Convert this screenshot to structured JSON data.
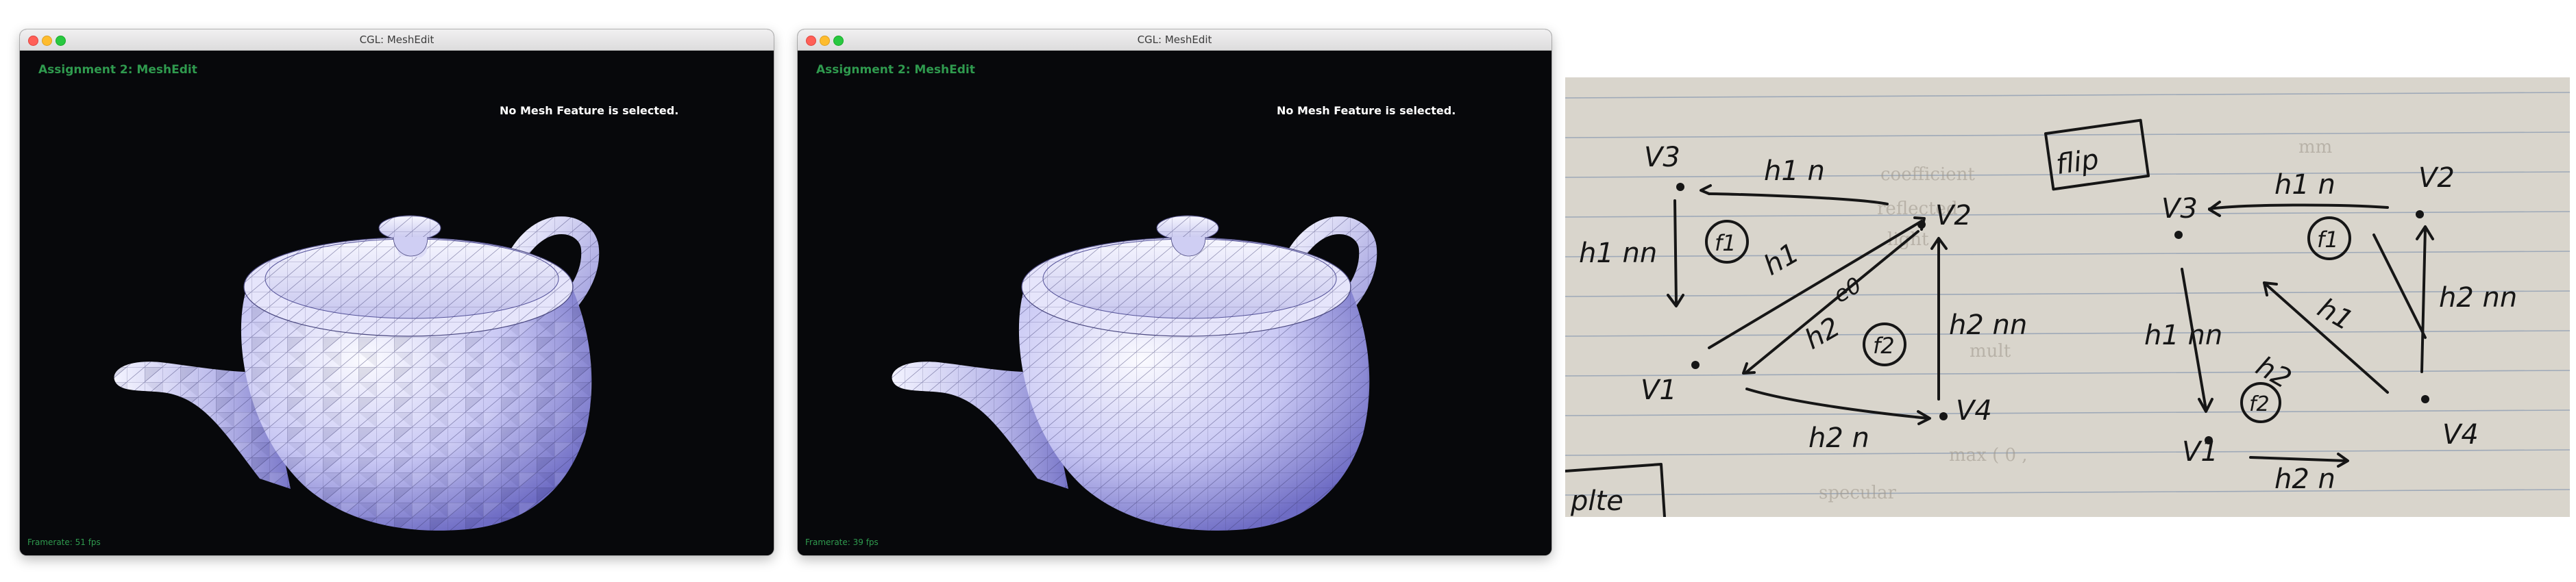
{
  "windows": [
    {
      "title": "CGL: MeshEdit",
      "app_title": "Assignment 2: MeshEdit",
      "status": "No Mesh Feature is selected.",
      "framerate": "Framerate: 51 fps",
      "shading": "flat-faceted"
    },
    {
      "title": "CGL: MeshEdit",
      "app_title": "Assignment 2: MeshEdit",
      "status": "No Mesh Feature is selected.",
      "framerate": "Framerate: 39 fps",
      "shading": "smooth"
    }
  ],
  "notes": {
    "flip_label": "flip",
    "left": {
      "vertices": [
        "V3",
        "V2",
        "V1",
        "V4"
      ],
      "halfedges": [
        "h1 n",
        "h1 nn",
        "h1",
        "h2",
        "h2 nn",
        "h2 n"
      ],
      "edge": "e0",
      "faces": [
        "f1",
        "f2"
      ]
    },
    "right": {
      "vertices": [
        "V3",
        "V2",
        "V1",
        "V4"
      ],
      "halfedges": [
        "h1 n",
        "h1",
        "h2",
        "h2 nn",
        "h1 nn",
        "h2 n"
      ],
      "faces": [
        "f1",
        "f2"
      ]
    },
    "fragments": [
      "plte"
    ]
  },
  "colors": {
    "window_bg": "#07080b",
    "app_title": "#2f9a4e",
    "framerate": "#2f9a4e",
    "teapot_light": "#f2f1ff",
    "teapot_dark": "#5a58b0",
    "paper": "#d9d5cc",
    "ink": "#161616"
  },
  "icons": [
    "close-icon",
    "minimize-icon",
    "maximize-icon"
  ]
}
